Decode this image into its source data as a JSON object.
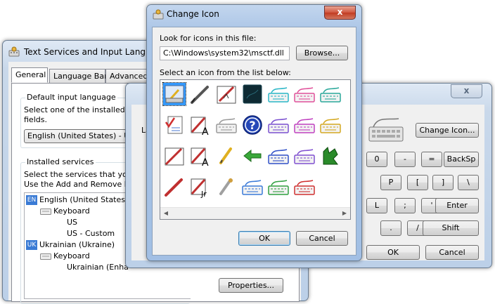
{
  "text_services": {
    "title": "Text Services and Input Languages",
    "tabs": [
      "General",
      "Language Bar",
      "Advanced"
    ],
    "default_group_title": "Default input language",
    "default_desc_1": "Select one of the installed inp",
    "default_desc_2": "fields.",
    "default_lang_value": "English (United States) - US",
    "installed_group_title": "Installed services",
    "installed_desc_1": "Select the services that you w",
    "installed_desc_2": "Use the Add and Remove bu",
    "tree": [
      {
        "tag": "EN",
        "label": "English (United States)"
      },
      {
        "label": "Keyboard"
      },
      {
        "label": "US"
      },
      {
        "label": "US - Custom"
      },
      {
        "tag": "UK",
        "label": "Ukrainian (Ukraine)"
      },
      {
        "label": "Keyboard"
      },
      {
        "label": "Ukrainian (Enha"
      }
    ],
    "properties_button": "Properties..."
  },
  "keyboard_window": {
    "partial_label": "La",
    "change_icon_button": "Change Icon...",
    "keys": [
      "0",
      "-",
      "=",
      "BackSp",
      "P",
      "[",
      "]",
      "\\",
      "L",
      ";",
      "'",
      "Enter",
      ".",
      "/",
      "Shift"
    ],
    "ok_button": "OK",
    "cancel_button": "Cancel"
  },
  "change_icon": {
    "title": "Change Icon",
    "look_for_label": "Look for icons in this file:",
    "file_path": "C:\\Windows\\system32\\msctf.dll",
    "browse_button": "Browse...",
    "select_label": "Select an icon from the list below:",
    "ok_button": "OK",
    "cancel_button": "Cancel",
    "close_glyph": "x",
    "icons": [
      "pen-tablet-icon",
      "pen-icon",
      "handwriting-pad-icon",
      "dark-square-icon",
      "keyboard-cyan-icon",
      "keyboard-pink-icon",
      "keyboard-teal-icon",
      "checklist-icon",
      "pen-character-icon",
      "keyboard-gray-icon",
      "help-icon",
      "keyboard-purple-icon",
      "keyboard-magenta-icon",
      "keyboard-yellow-icon",
      "pen-pad-icon",
      "pen-letter-icon",
      "pencil-yellow-icon",
      "arrow-left-icon",
      "keyboard-blue-icon",
      "keyboard-violet-icon",
      "green-shape-icon",
      "red-pen-icon",
      "pen-japanese-icon",
      "pencil-gray-icon",
      "keyboard-blue2-icon",
      "keyboard-green-icon",
      "keyboard-red-icon"
    ]
  }
}
